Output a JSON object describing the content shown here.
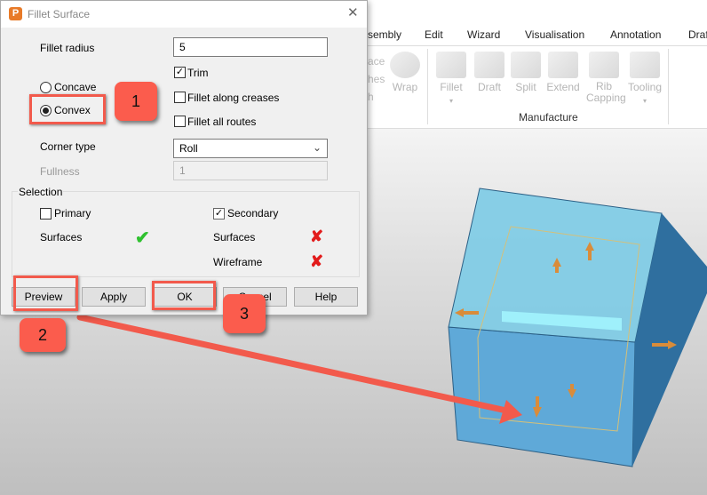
{
  "ribbon": {
    "tabs": [
      "sembly",
      "Edit",
      "Wizard",
      "Visualisation",
      "Annotation",
      "Draf"
    ],
    "partial_items": [
      "ace",
      "hes",
      "h"
    ],
    "tools": [
      {
        "label": "Wrap"
      },
      {
        "label": "Fillet",
        "arrow": "▾"
      },
      {
        "label": "Draft"
      },
      {
        "label": "Split"
      },
      {
        "label": "Extend"
      },
      {
        "label": "Rib Capping"
      },
      {
        "label": "Tooling",
        "arrow": "▾"
      }
    ],
    "group": "Manufacture"
  },
  "dialog": {
    "title": "Fillet Surface",
    "close": "✕",
    "fillet_radius_label": "Fillet radius",
    "fillet_radius_value": "5",
    "trim": "Trim",
    "trim_checked": true,
    "concave": "Concave",
    "convex": "Convex",
    "selected_mode": "Convex",
    "fillet_along_creases": "Fillet along creases",
    "fillet_all_routes": "Fillet all routes",
    "corner_type_label": "Corner type",
    "corner_type_value": "Roll",
    "fullness_label": "Fullness",
    "fullness_value": "1",
    "selection": {
      "title": "Selection",
      "primary": "Primary",
      "primary_checked": false,
      "primary_surfaces": "Surfaces",
      "secondary": "Secondary",
      "secondary_checked": true,
      "secondary_surfaces": "Surfaces",
      "wireframe": "Wireframe"
    },
    "buttons": {
      "preview": "Preview",
      "apply": "Apply",
      "ok": "OK",
      "cancel": "Cancel",
      "help": "Help"
    }
  },
  "annotations": {
    "badge1": "1",
    "badge2": "2",
    "badge3": "3",
    "color": "#f25a4c"
  }
}
